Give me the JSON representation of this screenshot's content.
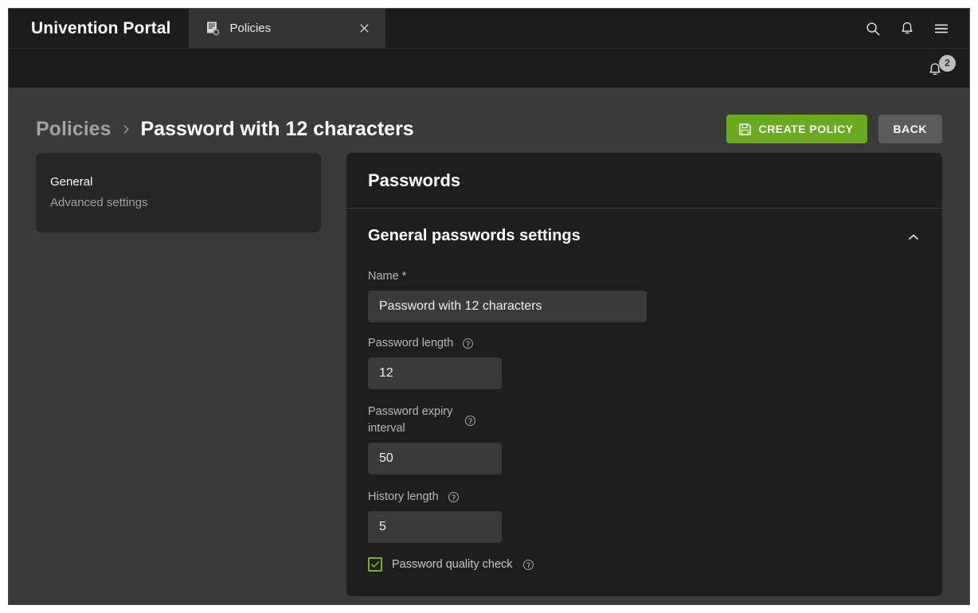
{
  "colors": {
    "accent_green": "#6aaa1e",
    "checkbox_green": "#7ab51d",
    "window_bg": "#3a3a3a",
    "card_bg": "#1e1e1e",
    "navcard_bg": "#262626",
    "topbar_bg": "#1c1c1c",
    "tab_active_bg": "#333333",
    "input_bg": "#3a3a3a",
    "badge_bg": "#bdbdbd"
  },
  "topbar": {
    "brand": "Univention Portal",
    "tab": {
      "label": "Policies",
      "icon": "policy-document-icon",
      "close_icon": "close-icon"
    },
    "icons": [
      {
        "name": "search-icon"
      },
      {
        "name": "bell-icon"
      },
      {
        "name": "hamburger-menu-icon"
      }
    ]
  },
  "subbar": {
    "notification": {
      "icon": "bell-icon",
      "badge_count": "2"
    }
  },
  "header": {
    "breadcrumb": {
      "parent": "Policies",
      "separator": "›",
      "current": "Password with 12 characters"
    },
    "actions": {
      "create_label": "CREATE POLICY",
      "create_icon": "save-floppy-icon",
      "back_label": "BACK"
    }
  },
  "sidebar": {
    "items": [
      {
        "label": "General",
        "active": true
      },
      {
        "label": "Advanced settings",
        "active": false
      }
    ]
  },
  "main": {
    "title": "Passwords",
    "section": {
      "title": "General passwords settings",
      "collapse_icon": "chevron-up-icon",
      "expanded": true,
      "fields": [
        {
          "label": "Name *",
          "value": "Password with 12 characters",
          "placeholder": "",
          "has_help": false,
          "width": "wide"
        },
        {
          "label": "Password length",
          "value": "12",
          "placeholder": "",
          "has_help": true,
          "width": "narrow"
        },
        {
          "label": "Password expiry interval",
          "value": "50",
          "placeholder": "",
          "has_help": true,
          "width": "narrow"
        },
        {
          "label": "History length",
          "value": "5",
          "placeholder": "",
          "has_help": true,
          "width": "narrow"
        }
      ],
      "checkbox": {
        "label": "Password quality check",
        "checked": true,
        "has_help": true
      }
    }
  }
}
